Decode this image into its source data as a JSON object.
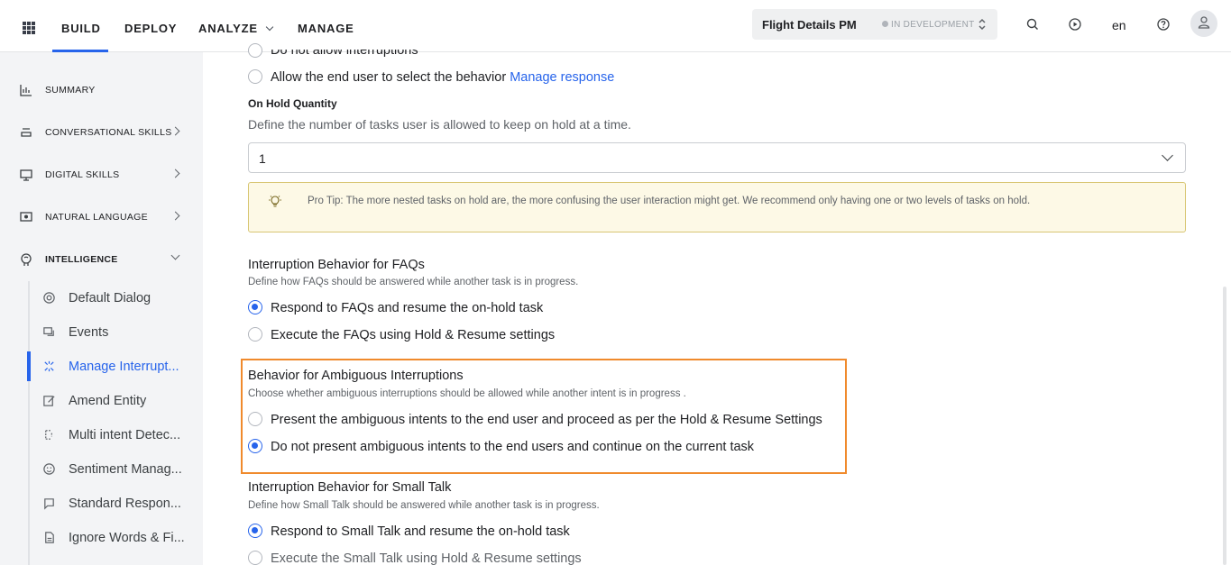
{
  "topbar": {
    "nav": [
      {
        "label": "BUILD",
        "active": true
      },
      {
        "label": "DEPLOY"
      },
      {
        "label": "ANALYZE"
      },
      {
        "label": "MANAGE"
      }
    ],
    "bot_name": "Flight Details PM",
    "bot_status": "IN DEVELOPMENT",
    "language": "en"
  },
  "sidebar": {
    "items": [
      {
        "label": "SUMMARY",
        "icon": "bar-chart-icon"
      },
      {
        "label": "CONVERSATIONAL SKILLS",
        "icon": "stack-icon"
      },
      {
        "label": "DIGITAL SKILLS",
        "icon": "monitor-icon"
      },
      {
        "label": "NATURAL LANGUAGE",
        "icon": "nlp-icon"
      },
      {
        "label": "INTELLIGENCE",
        "icon": "brain-icon"
      }
    ],
    "sub_items": [
      {
        "label": "Default Dialog",
        "icon": "dialog-icon"
      },
      {
        "label": "Events",
        "icon": "events-icon"
      },
      {
        "label": "Manage Interrupt...",
        "icon": "interrupt-icon",
        "active": true
      },
      {
        "label": "Amend Entity",
        "icon": "edit-icon"
      },
      {
        "label": "Multi intent Detec...",
        "icon": "multi-intent-icon"
      },
      {
        "label": "Sentiment Manag...",
        "icon": "smiley-icon"
      },
      {
        "label": "Standard Respon...",
        "icon": "chat-icon"
      },
      {
        "label": "Ignore Words & Fi...",
        "icon": "document-icon"
      }
    ]
  },
  "main": {
    "top_partial_option": "Do not allow interruptions",
    "allow_end_user_option": "Allow the end user to select the behavior",
    "manage_response_link": "Manage response",
    "on_hold": {
      "title": "On Hold Quantity",
      "desc": "Define the number of tasks user is allowed to keep on hold at a time.",
      "value": "1"
    },
    "tip": "Pro Tip: The more nested tasks on hold are, the more confusing the user interaction might get. We recommend only having one or two levels of tasks on hold.",
    "faqs": {
      "title": "Interruption Behavior for FAQs",
      "desc": "Define how FAQs should be answered while another task is in progress.",
      "options": [
        {
          "label": "Respond to FAQs and resume the on-hold task",
          "checked": true
        },
        {
          "label": "Execute the FAQs using Hold & Resume settings",
          "checked": false
        }
      ]
    },
    "ambiguous": {
      "title": "Behavior for Ambiguous Interruptions",
      "desc": "Choose whether ambiguous interruptions should be allowed while another intent is in progress .",
      "options": [
        {
          "label": "Present the ambiguous intents to the end user and proceed as per the Hold & Resume Settings",
          "checked": false
        },
        {
          "label": "Do not present ambiguous intents to the end users and continue on the current task",
          "checked": true
        }
      ]
    },
    "small_talk": {
      "title": "Interruption Behavior for Small Talk",
      "desc": "Define how Small Talk should be answered while another task is in progress.",
      "options": [
        {
          "label": "Respond to Small Talk and resume the on-hold task",
          "checked": true
        },
        {
          "label": "Execute the Small Talk using Hold & Resume settings",
          "checked": false
        }
      ]
    }
  },
  "colors": {
    "accent": "#2764eb",
    "highlight_border": "#f08a2c",
    "tip_background": "#fdf9e6"
  }
}
